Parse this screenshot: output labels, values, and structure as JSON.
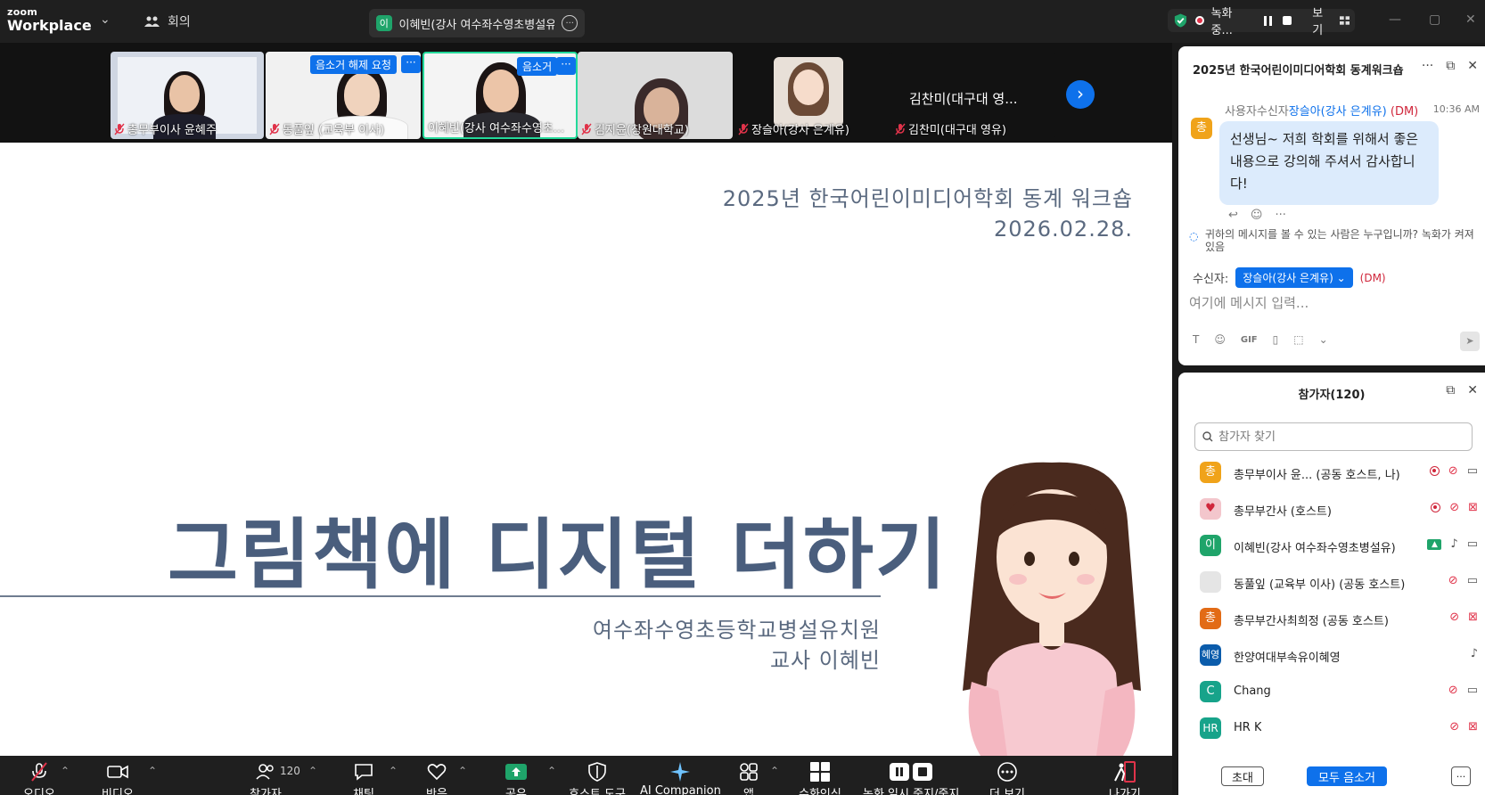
{
  "app": {
    "brand_small": "zoom",
    "brand_name": "Workplace"
  },
  "topbar": {
    "meeting_tab": "회의",
    "active_speaker": {
      "avatar": "이",
      "name": "이혜빈(강사 여수좌수영초병설유치원)"
    },
    "recording_label": "녹화 중...",
    "view_label": "보기"
  },
  "gallery": {
    "tiles": [
      {
        "name": "총무부이사 윤혜주",
        "muted": true
      },
      {
        "name": "동풀잎 (교육부 이사)",
        "muted": true,
        "badge": "음소거 해제 요청",
        "more": "···"
      },
      {
        "name": "이혜빈(강사 여수좌수영초...",
        "muted": false,
        "badge": "음소거",
        "more": "···",
        "active": true
      },
      {
        "name": "김지윤(창원대학교)",
        "muted": true
      },
      {
        "name": "장슬아(강사 은계유)",
        "muted": true
      },
      {
        "name": "김찬미(대구대 영유)",
        "muted": true,
        "header": "김찬미(대구대 영..."
      }
    ],
    "next": "›"
  },
  "slide": {
    "header_line1": "2025년 한국어린이미디어학회 동계 워크숍",
    "header_line2": "2026.02.28.",
    "title": "그림책에 디지털 더하기",
    "sub_line1": "여수좌수영초등학교병설유치원",
    "sub_line2": "교사 이혜빈"
  },
  "toolbar": {
    "audio": "오디오",
    "video": "비디오",
    "participants": "참가자",
    "participants_count": "120",
    "chat": "채팅",
    "react": "반응",
    "share": "공유",
    "host_tools": "호스트 도구",
    "ai": "AI Companion",
    "apps": "앱",
    "captions": "수화인식",
    "rec_ctrl": "녹화 일시 중지/중지",
    "more": "더 보기",
    "leave": "나가기"
  },
  "chat": {
    "title": "2025년 한국어린이미디어학회 동계워크숍",
    "meta_prefix": "사용자수신자",
    "sender": "장슬아(강사 은계유)",
    "dm": "(DM)",
    "time": "10:36 AM",
    "avatar": "총",
    "message": "선생님~ 저희 학회를 위해서 좋은 내용으로 강의해 주셔서 감사합니다!",
    "visibility_note": "귀하의 메시지를 볼 수 있는 사람은 누구입니까? 녹화가 켜져 있음",
    "to_label": "수신자:",
    "to_value": "장슬아(강사 은계유)",
    "to_dm": "(DM)",
    "input_placeholder": "여기에 메시지 입력..."
  },
  "participants": {
    "title": "참가자(120)",
    "search_placeholder": "참가자 찾기",
    "list": [
      {
        "avatar": "총",
        "color": "#f0a31a",
        "name": "총무부이사 윤... (공동 호스트, 나)"
      },
      {
        "avatar": "♥",
        "color": "#f3c6cc",
        "name": "총무부간사 (호스트)"
      },
      {
        "avatar": "이",
        "color": "#1fa46a",
        "name": "이혜빈(강사 여수좌수영초병설유)"
      },
      {
        "avatar": "",
        "color": "#e5e5e5",
        "name": "동풀잎 (교육부 이사) (공동 호스트)"
      },
      {
        "avatar": "총",
        "color": "#e26b16",
        "name": "총무부간사최희정 (공동 호스트)"
      },
      {
        "avatar": "혜영",
        "color": "#0b5cab",
        "name": "한양여대부속유이혜영"
      },
      {
        "avatar": "C",
        "color": "#17a38a",
        "name": "Chang"
      },
      {
        "avatar": "HR",
        "color": "#17a38a",
        "name": "HR K"
      }
    ],
    "invite": "초대",
    "mute_all": "모두 음소거",
    "more": "···"
  }
}
